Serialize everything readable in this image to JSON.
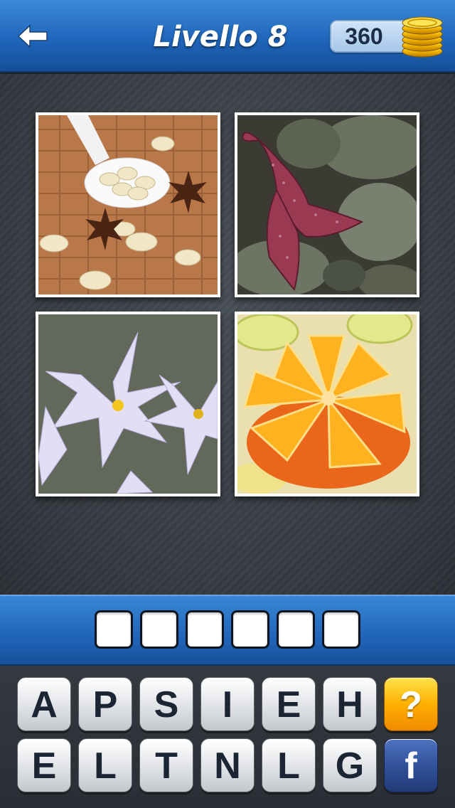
{
  "header": {
    "title": "Livello 8",
    "coins": "360",
    "icons": {
      "back": "back-arrow-icon",
      "coins": "gold-coins-icon"
    }
  },
  "puzzle": {
    "images": [
      {
        "subject": "almonds-star-anise"
      },
      {
        "subject": "starfish-rocks"
      },
      {
        "subject": "white-lilac-flowers"
      },
      {
        "subject": "carved-orange"
      }
    ]
  },
  "answer": {
    "slots": [
      "",
      "",
      "",
      "",
      "",
      ""
    ]
  },
  "keyboard": {
    "row1": [
      "A",
      "P",
      "S",
      "I",
      "E",
      "H"
    ],
    "row2": [
      "E",
      "L",
      "T",
      "N",
      "L",
      "G"
    ],
    "hint_label": "?",
    "facebook_label": "f"
  },
  "colors": {
    "header_blue": "#1f66bb",
    "hint_orange": "#ffb000",
    "facebook_blue": "#2f4f96"
  }
}
